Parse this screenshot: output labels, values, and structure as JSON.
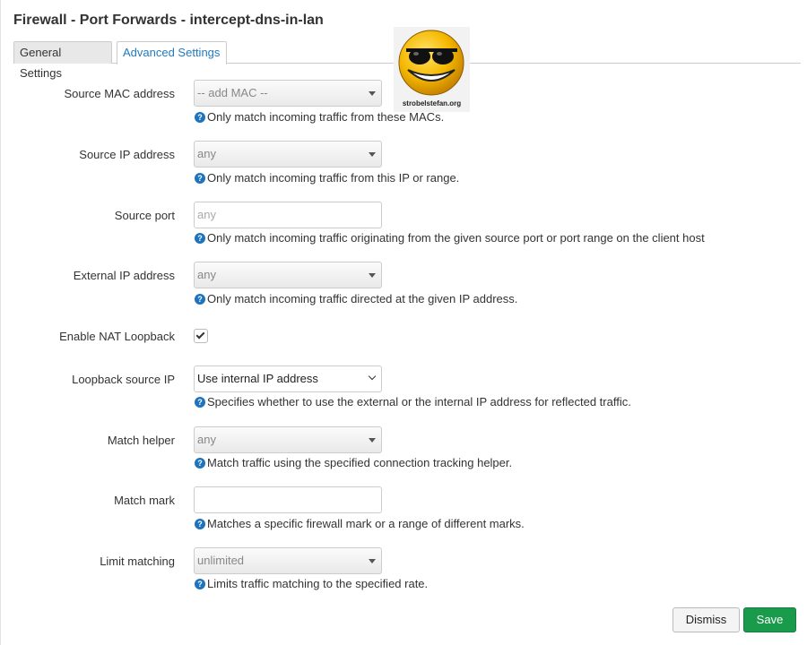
{
  "title": "Firewall - Port Forwards - intercept-dns-in-lan",
  "tabs": [
    {
      "label": "General Settings",
      "active": false
    },
    {
      "label": "Advanced Settings",
      "active": true
    }
  ],
  "logo": {
    "text": "strobelstefan.org"
  },
  "help_icon_glyph": "?",
  "fields": {
    "source_mac": {
      "label": "Source MAC address",
      "value": "-- add MAC --",
      "help": "Only match incoming traffic from these MACs."
    },
    "source_ip": {
      "label": "Source IP address",
      "value": "any",
      "help": "Only match incoming traffic from this IP or range."
    },
    "source_port": {
      "label": "Source port",
      "placeholder": "any",
      "help": "Only match incoming traffic originating from the given source port or port range on the client host"
    },
    "external_ip": {
      "label": "External IP address",
      "value": "any",
      "help": "Only match incoming traffic directed at the given IP address."
    },
    "nat_loopback": {
      "label": "Enable NAT Loopback",
      "checked": true
    },
    "loopback_source_ip": {
      "label": "Loopback source IP",
      "value": "Use internal IP address",
      "help": "Specifies whether to use the external or the internal IP address for reflected traffic."
    },
    "match_helper": {
      "label": "Match helper",
      "value": "any",
      "help": "Match traffic using the specified connection tracking helper."
    },
    "match_mark": {
      "label": "Match mark",
      "value": "",
      "help": "Matches a specific firewall mark or a range of different marks."
    },
    "limit_matching": {
      "label": "Limit matching",
      "value": "unlimited",
      "help": "Limits traffic matching to the specified rate."
    }
  },
  "buttons": {
    "dismiss": "Dismiss",
    "save": "Save"
  },
  "colors": {
    "accent": "#1f7bc1",
    "save": "#1a9a4b",
    "help_icon": "#1e73be"
  }
}
